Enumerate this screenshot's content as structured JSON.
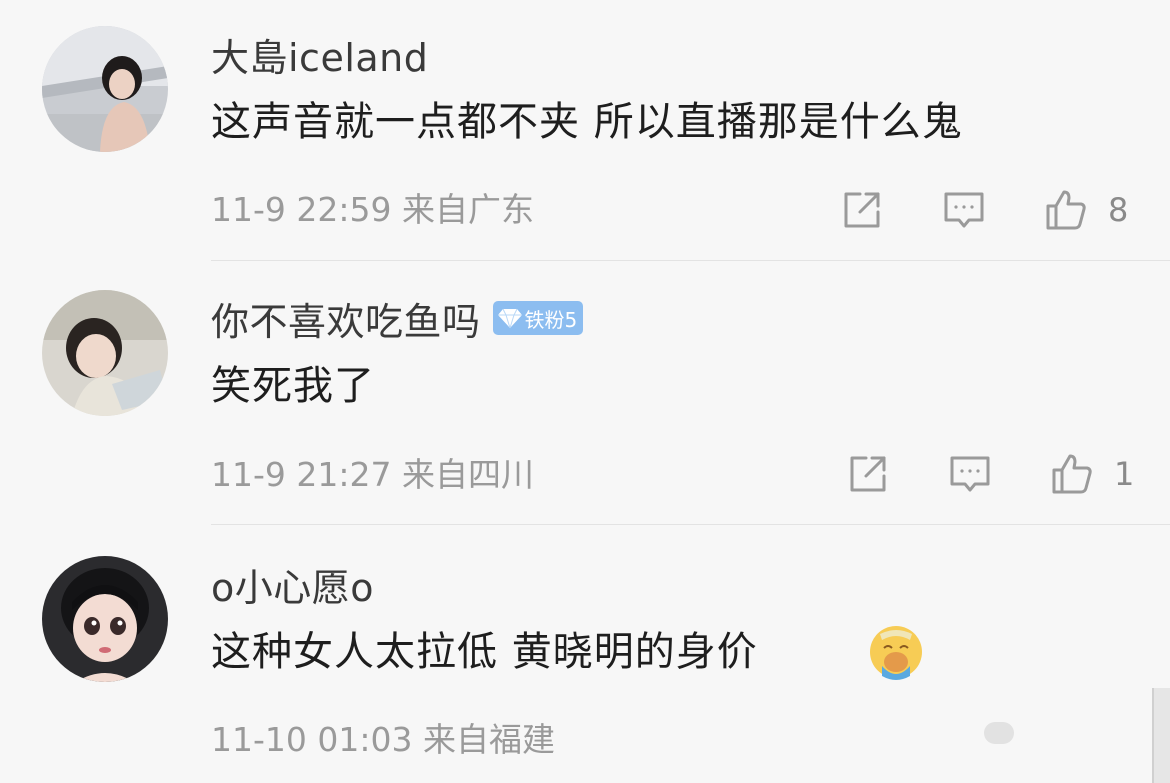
{
  "comments": [
    {
      "username": "大島iceland",
      "badge": null,
      "text": "这声音就一点都不夹 所以直播那是什么鬼",
      "meta": "11-9 22:59 来自广东",
      "like_count": "8",
      "icons": {
        "avatar": "avatar-photo",
        "share": "share-icon",
        "reply": "comment-icon",
        "like": "thumbs-up-icon"
      }
    },
    {
      "username": "你不喜欢吃鱼吗",
      "badge": "铁粉5",
      "text": "笑死我了",
      "meta": "11-9 21:27 来自四川",
      "like_count": "1",
      "icons": {
        "avatar": "avatar-photo",
        "badge": "diamond-icon",
        "share": "share-icon",
        "reply": "comment-icon",
        "like": "thumbs-up-icon"
      }
    },
    {
      "username": "o小心愿o",
      "badge": null,
      "text": "这种女人太拉低 黄晓明的身价",
      "meta": "11-10 01:03 来自福建",
      "like_count": null,
      "icons": {
        "avatar": "avatar-illustration",
        "emoji": "crying-emoji-icon"
      }
    }
  ],
  "colors": {
    "background": "#f7f7f7",
    "badge": "#8cbdf0",
    "meta_text": "#9a9a9a",
    "divider": "#e3e3e3"
  }
}
